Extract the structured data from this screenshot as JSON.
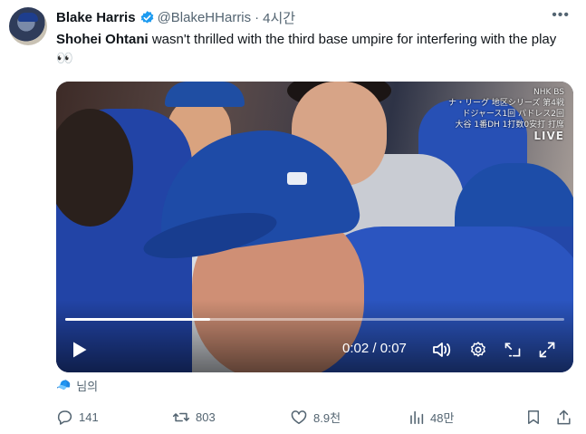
{
  "author": {
    "name": "Blake Harris",
    "handle": "@BlakeHHarris",
    "separator": "·",
    "time": "4시간"
  },
  "tweet": {
    "bold": "Shohei Ohtani",
    "text": " wasn't thrilled with the third base umpire for interfering with the play",
    "emoji": "👀"
  },
  "video": {
    "overlay_lines": [
      "ナ・リーグ 地区シリーズ 第4戦",
      "ドジャース1回 パドレス2回",
      "大谷 1番DH 1打数0安打 打席"
    ],
    "overlay_brand": "NHK BS",
    "overlay_live": "LIVE",
    "time": "0:02 / 0:07",
    "progress": 0.29
  },
  "tag": {
    "emoji": "🧢",
    "label": "님의"
  },
  "actions": {
    "replies": "141",
    "reposts": "803",
    "likes": "8.9천",
    "views": "48만"
  },
  "colors": {
    "text": "#0f1419",
    "muted": "#536471",
    "verified": "#1d9bf0",
    "dodger_blue": "#1e4ba7"
  }
}
